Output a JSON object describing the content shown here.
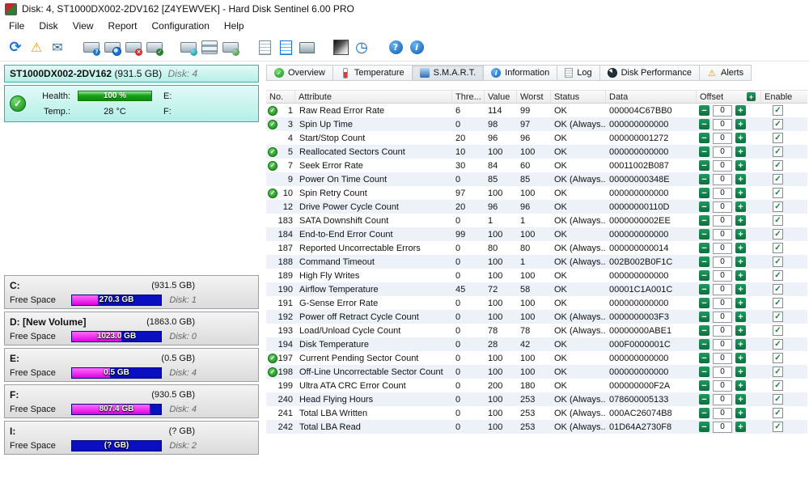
{
  "window": {
    "title": "Disk: 4, ST1000DX002-2DV162 [Z4YEWVEK]  -  Hard Disk Sentinel 6.00 PRO"
  },
  "menu": {
    "items": [
      "File",
      "Disk",
      "View",
      "Report",
      "Configuration",
      "Help"
    ]
  },
  "toolbar": {
    "groups": [
      [
        "refresh",
        "report-warning",
        "report-mail"
      ],
      [
        "disk-question",
        "disk-search",
        "disk-error",
        "disk-ok"
      ],
      [
        "disk-network",
        "disk-stack",
        "disk-globe"
      ],
      [
        "report-document",
        "report-chart",
        "report-print"
      ],
      [
        "surface-test",
        "access-time"
      ],
      [
        "help",
        "info"
      ]
    ]
  },
  "colors": {
    "panel_cyan": "#b4efe8",
    "health_green": "#18a318",
    "capacity_blue": "#0a10c0",
    "free_space_magenta": "#ee00ee",
    "ok_green": "#118a11",
    "offset_button_green": "#0e6e3e"
  },
  "sidebar": {
    "disk": {
      "name": "ST1000DX002-2DV162",
      "size": "(931.5 GB)",
      "disk_label": "Disk: 4"
    },
    "health_label": "Health:",
    "health_value": "100 %",
    "temp_label": "Temp.:",
    "temp_value": "28 °C",
    "drive_e": "E:",
    "drive_f": "F:",
    "partitions": [
      {
        "letter": "C:",
        "size": "(931.5 GB)",
        "free_label": "Free Space",
        "free": "270.3 GB",
        "disk": "Disk: 1",
        "fill_pct": 29
      },
      {
        "letter": "D: [New Volume]",
        "size": "(1863.0 GB)",
        "free_label": "Free Space",
        "free": "1023.0 GB",
        "disk": "Disk: 0",
        "fill_pct": 55
      },
      {
        "letter": "E:",
        "size": "(0.5 GB)",
        "free_label": "Free Space",
        "free": "0.5 GB",
        "disk": "Disk: 4",
        "fill_pct": 43
      },
      {
        "letter": "F:",
        "size": "(930.5 GB)",
        "free_label": "Free Space",
        "free": "807.4 GB",
        "disk": "Disk: 4",
        "fill_pct": 87
      },
      {
        "letter": "I:",
        "size": "(? GB)",
        "free_label": "Free Space",
        "free": "(? GB)",
        "disk": "Disk: 2",
        "fill_pct": 0
      }
    ]
  },
  "tabs": {
    "active": "S.M.A.R.T.",
    "items": [
      {
        "label": "Overview",
        "icon": "overview"
      },
      {
        "label": "Temperature",
        "icon": "temperature"
      },
      {
        "label": "S.M.A.R.T.",
        "icon": "smart"
      },
      {
        "label": "Information",
        "icon": "information"
      },
      {
        "label": "Log",
        "icon": "log"
      },
      {
        "label": "Disk Performance",
        "icon": "performance"
      },
      {
        "label": "Alerts",
        "icon": "alerts"
      }
    ]
  },
  "smart": {
    "headers": {
      "no": "No.",
      "attribute": "Attribute",
      "threshold": "Thre...",
      "value": "Value",
      "worst": "Worst",
      "status": "Status",
      "data": "Data",
      "offset": "Offset",
      "enable": "Enable"
    },
    "rows": [
      {
        "check": true,
        "no": "1",
        "attribute": "Raw Read Error Rate",
        "threshold": "6",
        "value": "114",
        "worst": "99",
        "status": "OK",
        "data": "000004C67BB0",
        "offset": "0",
        "enabled": true
      },
      {
        "check": true,
        "no": "3",
        "attribute": "Spin Up Time",
        "threshold": "0",
        "value": "98",
        "worst": "97",
        "status": "OK (Always...",
        "data": "000000000000",
        "offset": "0",
        "enabled": true
      },
      {
        "check": false,
        "no": "4",
        "attribute": "Start/Stop Count",
        "threshold": "20",
        "value": "96",
        "worst": "96",
        "status": "OK",
        "data": "000000001272",
        "offset": "0",
        "enabled": true
      },
      {
        "check": true,
        "no": "5",
        "attribute": "Reallocated Sectors Count",
        "threshold": "10",
        "value": "100",
        "worst": "100",
        "status": "OK",
        "data": "000000000000",
        "offset": "0",
        "enabled": true
      },
      {
        "check": true,
        "no": "7",
        "attribute": "Seek Error Rate",
        "threshold": "30",
        "value": "84",
        "worst": "60",
        "status": "OK",
        "data": "00011002B087",
        "offset": "0",
        "enabled": true
      },
      {
        "check": false,
        "no": "9",
        "attribute": "Power On Time Count",
        "threshold": "0",
        "value": "85",
        "worst": "85",
        "status": "OK (Always...",
        "data": "00000000348E",
        "offset": "0",
        "enabled": true
      },
      {
        "check": true,
        "no": "10",
        "attribute": "Spin Retry Count",
        "threshold": "97",
        "value": "100",
        "worst": "100",
        "status": "OK",
        "data": "000000000000",
        "offset": "0",
        "enabled": true
      },
      {
        "check": false,
        "no": "12",
        "attribute": "Drive Power Cycle Count",
        "threshold": "20",
        "value": "96",
        "worst": "96",
        "status": "OK",
        "data": "00000000110D",
        "offset": "0",
        "enabled": true
      },
      {
        "check": false,
        "no": "183",
        "attribute": "SATA Downshift Count",
        "threshold": "0",
        "value": "1",
        "worst": "1",
        "status": "OK (Always...",
        "data": "0000000002EE",
        "offset": "0",
        "enabled": true
      },
      {
        "check": false,
        "no": "184",
        "attribute": "End-to-End Error Count",
        "threshold": "99",
        "value": "100",
        "worst": "100",
        "status": "OK",
        "data": "000000000000",
        "offset": "0",
        "enabled": true
      },
      {
        "check": false,
        "no": "187",
        "attribute": "Reported Uncorrectable Errors",
        "threshold": "0",
        "value": "80",
        "worst": "80",
        "status": "OK (Always...",
        "data": "000000000014",
        "offset": "0",
        "enabled": true
      },
      {
        "check": false,
        "no": "188",
        "attribute": "Command Timeout",
        "threshold": "0",
        "value": "100",
        "worst": "1",
        "status": "OK (Always...",
        "data": "002B002B0F1C",
        "offset": "0",
        "enabled": true
      },
      {
        "check": false,
        "no": "189",
        "attribute": "High Fly Writes",
        "threshold": "0",
        "value": "100",
        "worst": "100",
        "status": "OK",
        "data": "000000000000",
        "offset": "0",
        "enabled": true
      },
      {
        "check": false,
        "no": "190",
        "attribute": "Airflow Temperature",
        "threshold": "45",
        "value": "72",
        "worst": "58",
        "status": "OK",
        "data": "00001C1A001C",
        "offset": "0",
        "enabled": true
      },
      {
        "check": false,
        "no": "191",
        "attribute": "G-Sense Error Rate",
        "threshold": "0",
        "value": "100",
        "worst": "100",
        "status": "OK",
        "data": "000000000000",
        "offset": "0",
        "enabled": true
      },
      {
        "check": false,
        "no": "192",
        "attribute": "Power off Retract Cycle Count",
        "threshold": "0",
        "value": "100",
        "worst": "100",
        "status": "OK (Always...",
        "data": "0000000003F3",
        "offset": "0",
        "enabled": true
      },
      {
        "check": false,
        "no": "193",
        "attribute": "Load/Unload Cycle Count",
        "threshold": "0",
        "value": "78",
        "worst": "78",
        "status": "OK (Always...",
        "data": "00000000ABE1",
        "offset": "0",
        "enabled": true
      },
      {
        "check": false,
        "no": "194",
        "attribute": "Disk Temperature",
        "threshold": "0",
        "value": "28",
        "worst": "42",
        "status": "OK",
        "data": "000F0000001C",
        "offset": "0",
        "enabled": true
      },
      {
        "check": true,
        "no": "197",
        "attribute": "Current Pending Sector Count",
        "threshold": "0",
        "value": "100",
        "worst": "100",
        "status": "OK",
        "data": "000000000000",
        "offset": "0",
        "enabled": true
      },
      {
        "check": true,
        "no": "198",
        "attribute": "Off-Line Uncorrectable Sector Count",
        "threshold": "0",
        "value": "100",
        "worst": "100",
        "status": "OK",
        "data": "000000000000",
        "offset": "0",
        "enabled": true
      },
      {
        "check": false,
        "no": "199",
        "attribute": "Ultra ATA CRC Error Count",
        "threshold": "0",
        "value": "200",
        "worst": "180",
        "status": "OK",
        "data": "000000000F2A",
        "offset": "0",
        "enabled": true
      },
      {
        "check": false,
        "no": "240",
        "attribute": "Head Flying Hours",
        "threshold": "0",
        "value": "100",
        "worst": "253",
        "status": "OK (Always...",
        "data": "078600005133",
        "offset": "0",
        "enabled": true
      },
      {
        "check": false,
        "no": "241",
        "attribute": "Total LBA Written",
        "threshold": "0",
        "value": "100",
        "worst": "253",
        "status": "OK (Always...",
        "data": "000AC26074B8",
        "offset": "0",
        "enabled": true
      },
      {
        "check": false,
        "no": "242",
        "attribute": "Total LBA Read",
        "threshold": "0",
        "value": "100",
        "worst": "253",
        "status": "OK (Always...",
        "data": "01D64A2730F8",
        "offset": "0",
        "enabled": true
      }
    ]
  }
}
